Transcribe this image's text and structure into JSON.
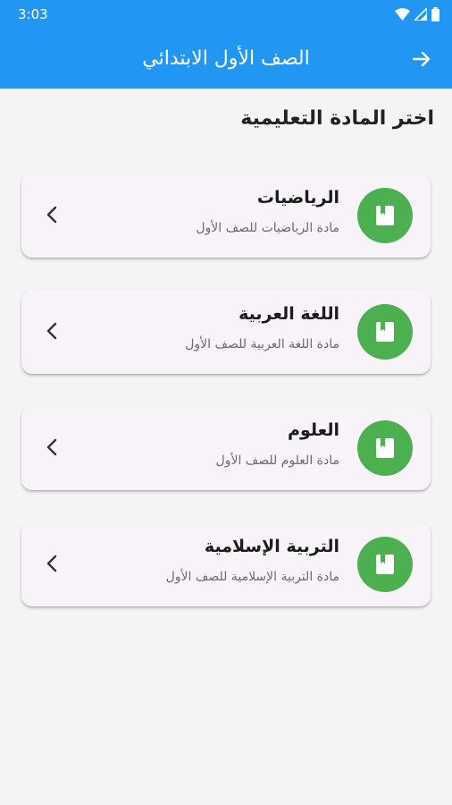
{
  "status_bar": {
    "time": "3:03"
  },
  "app_bar": {
    "title": "الصف الأول الابتدائي"
  },
  "section": {
    "title": "اختر المادة التعليمية"
  },
  "subjects": [
    {
      "title": "الرياضيات",
      "subtitle": "مادة الرياضيات للصف الأول"
    },
    {
      "title": "اللغة العربية",
      "subtitle": "مادة اللغة العربية للصف الأول"
    },
    {
      "title": "العلوم",
      "subtitle": "مادة العلوم للصف الأول"
    },
    {
      "title": "التربية الإسلامية",
      "subtitle": "مادة التربية الإسلامية للصف الأول"
    }
  ],
  "colors": {
    "primary": "#2196f3",
    "icon_circle": "#4caf50",
    "card_bg": "#f7f3f9",
    "page_bg": "#f4f4f4"
  },
  "icons": {
    "back": "arrow-forward-icon",
    "subject": "book-icon",
    "chevron": "chevron-left-icon"
  }
}
